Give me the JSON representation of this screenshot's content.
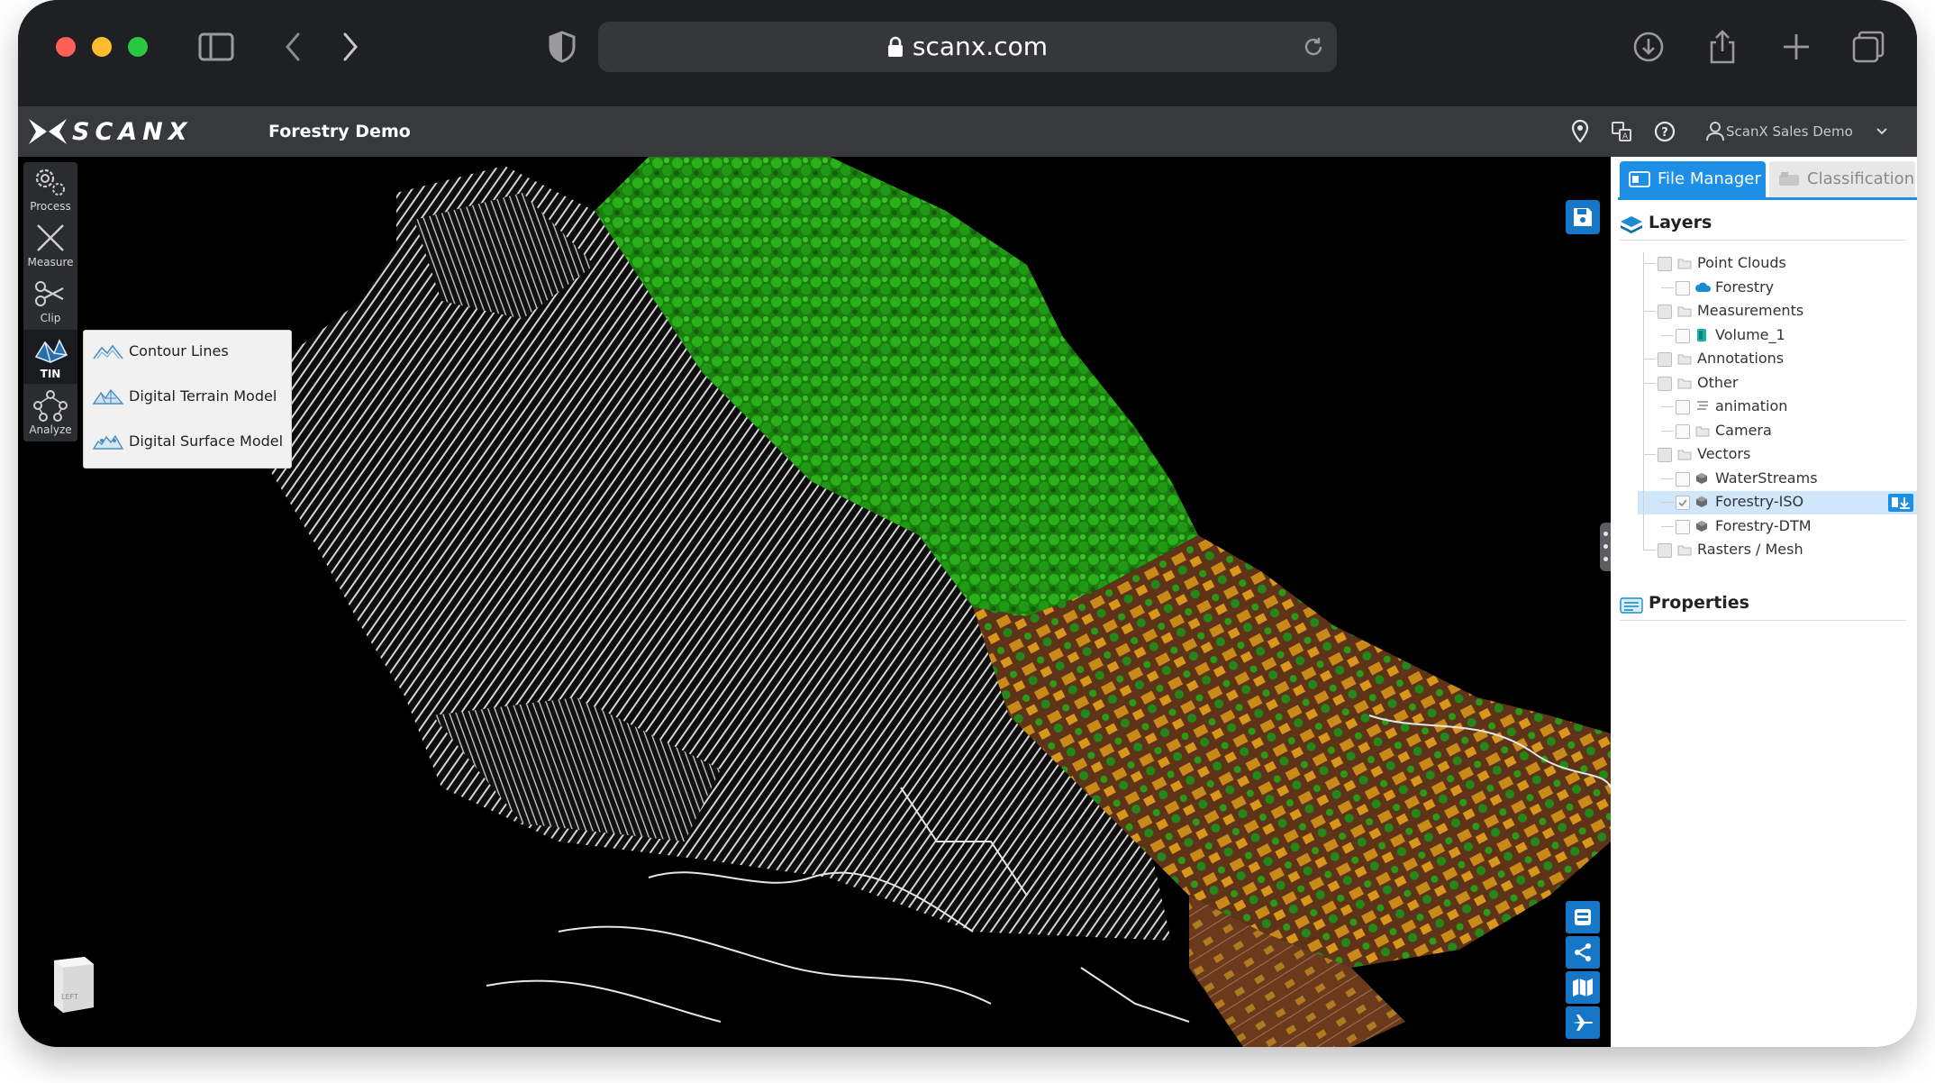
{
  "browser": {
    "url": "scanx.com",
    "colors": {
      "close": "#fe5f57",
      "minimize": "#febc2e",
      "zoom": "#28c840"
    },
    "icons": [
      "sidebar-icon",
      "back-icon",
      "forward-icon",
      "shield-icon",
      "lock-icon",
      "reload-icon",
      "download-icon",
      "share-icon",
      "new-tab-icon",
      "tabs-icon"
    ]
  },
  "app": {
    "logo_text": "SCANX",
    "project_title": "Forestry Demo",
    "user_label": "ScanX Sales Demo",
    "header_icons": [
      "location-pin-icon",
      "translate-icon",
      "help-icon",
      "user-icon",
      "chevron-down-icon"
    ]
  },
  "toolbar": {
    "tools": [
      {
        "label": "Process",
        "icon": "gears-icon"
      },
      {
        "label": "Measure",
        "icon": "measure-icon"
      },
      {
        "label": "Clip",
        "icon": "scissors-icon"
      },
      {
        "label": "TIN",
        "icon": "tin-icon",
        "active": true
      },
      {
        "label": "Analyze",
        "icon": "network-icon"
      }
    ]
  },
  "tin_menu": {
    "items": [
      {
        "label": "Contour Lines",
        "icon": "contour-icon"
      },
      {
        "label": "Digital Terrain Model",
        "icon": "terrain-icon"
      },
      {
        "label": "Digital Surface Model",
        "icon": "surface-icon"
      }
    ]
  },
  "viewer": {
    "nav_cube_face": "LEFT",
    "colors": {
      "vegetation": "#1f9a13",
      "buildings": "#c98a1a",
      "ground": "#6b3a1c",
      "contours": "#d9d9d9",
      "button": "#1677c8"
    }
  },
  "panel": {
    "tabs": [
      {
        "label": "File Manager",
        "active": true
      },
      {
        "label": "Classification",
        "active": false
      }
    ],
    "layers_title": "Layers",
    "properties_title": "Properties",
    "tree": [
      {
        "label": "Point Clouds",
        "level": 0,
        "icon": "folder-icon",
        "checked": false
      },
      {
        "label": "Forestry",
        "level": 1,
        "icon": "cloud-icon",
        "checked": false
      },
      {
        "label": "Measurements",
        "level": 0,
        "icon": "folder-icon",
        "checked": false
      },
      {
        "label": "Volume_1",
        "level": 1,
        "icon": "volume-icon",
        "checked": false
      },
      {
        "label": "Annotations",
        "level": 0,
        "icon": "folder-icon",
        "checked": false
      },
      {
        "label": "Other",
        "level": 0,
        "icon": "folder-icon",
        "checked": false
      },
      {
        "label": "animation",
        "level": 1,
        "icon": "animation-icon",
        "checked": false
      },
      {
        "label": "Camera",
        "level": 1,
        "icon": "folder-icon",
        "checked": false
      },
      {
        "label": "Vectors",
        "level": 0,
        "icon": "folder-icon",
        "checked": false
      },
      {
        "label": "WaterStreams",
        "level": 1,
        "icon": "vector-icon",
        "checked": false
      },
      {
        "label": "Forestry-ISO",
        "level": 1,
        "icon": "vector-icon",
        "checked": true,
        "selected": true
      },
      {
        "label": "Forestry-DTM",
        "level": 1,
        "icon": "vector-icon",
        "checked": false
      },
      {
        "label": "Rasters / Mesh",
        "level": 0,
        "icon": "folder-icon",
        "checked": false
      }
    ]
  }
}
